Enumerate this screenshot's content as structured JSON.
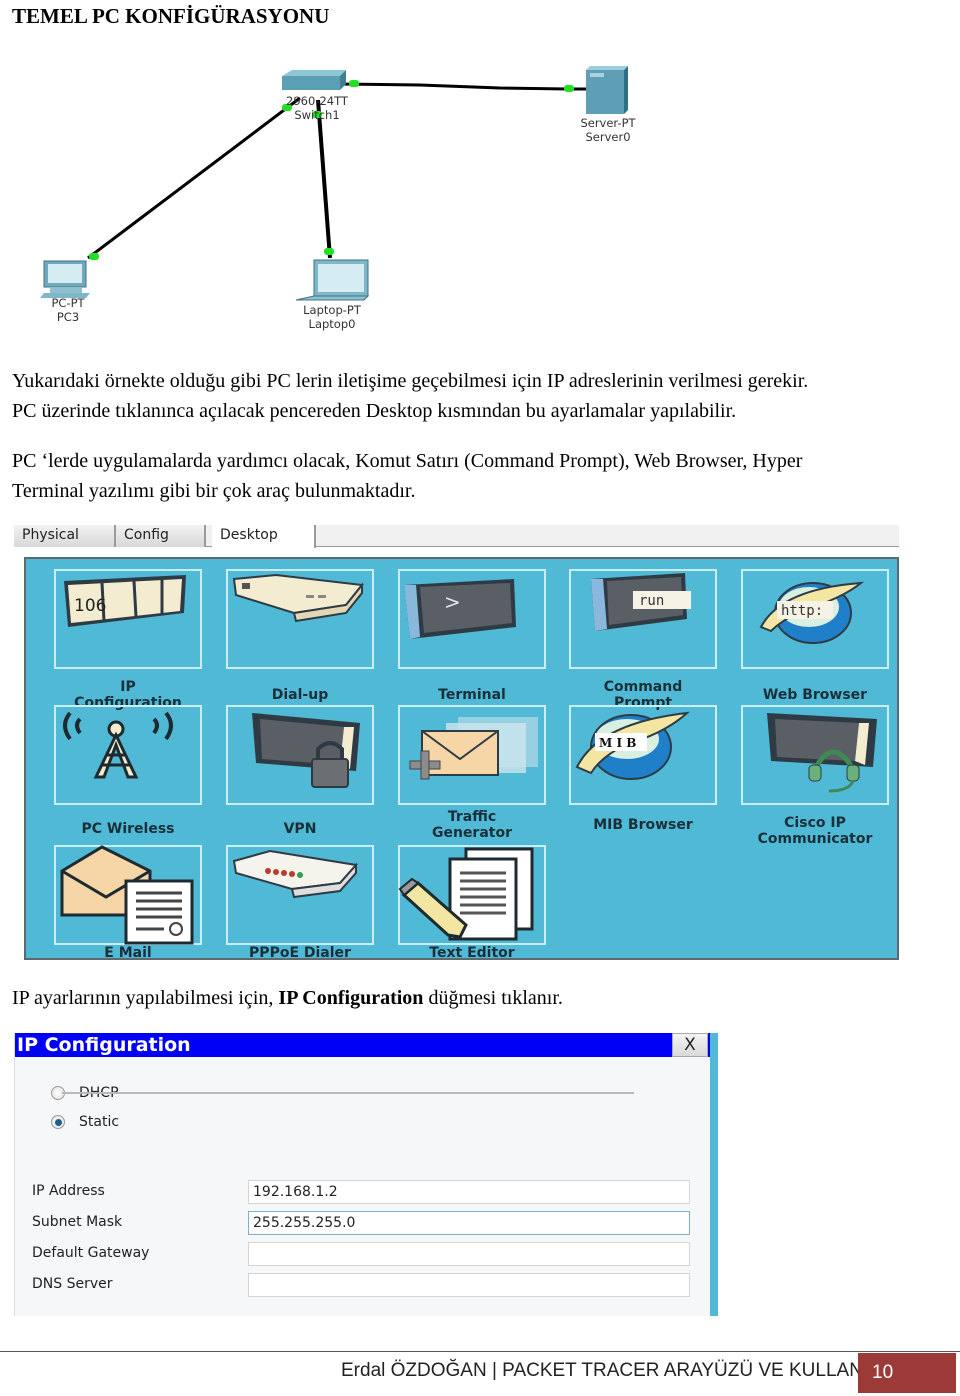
{
  "heading": "TEMEL PC KONFİGÜRASYONU",
  "topology": {
    "devices": [
      {
        "id": "switch",
        "model": "2960-24TT",
        "name": "Switch1",
        "icon": "switch-icon"
      },
      {
        "id": "server",
        "model": "Server-PT",
        "name": "Server0",
        "icon": "server-icon"
      },
      {
        "id": "pc",
        "model": "PC-PT",
        "name": "PC3",
        "icon": "desktop-pc-icon"
      },
      {
        "id": "laptop",
        "model": "Laptop-PT",
        "name": "Laptop0",
        "icon": "laptop-icon"
      }
    ],
    "links": [
      {
        "from": "switch",
        "to": "server",
        "status": "up"
      },
      {
        "from": "switch",
        "to": "pc",
        "status": "up"
      },
      {
        "from": "switch",
        "to": "laptop",
        "status": "up"
      }
    ],
    "link_color": "#000000",
    "link_light_color": "#22e022"
  },
  "paragraphs": {
    "p1_line1": "Yukarıdaki örnekte olduğu gibi PC lerin iletişime geçebilmesi için IP adreslerinin verilmesi gerekir.",
    "p1_line2": "PC üzerinde tıklanınca açılacak pencereden Desktop kısmından bu ayarlamalar yapılabilir.",
    "p2_line1": "PC ‘lerde uygulamalarda yardımcı olacak, Komut Satırı (Command Prompt), Web Browser, Hyper",
    "p2_line2": "Terminal yazılımı gibi bir çok araç bulunmaktadır.",
    "p3_pre": "IP ayarlarının yapılabilmesi için, ",
    "p3_bold": "IP Configuration",
    "p3_post": " düğmesi tıklanır."
  },
  "device_window": {
    "tabs": [
      {
        "label": "Physical",
        "active": false
      },
      {
        "label": "Config",
        "active": false
      },
      {
        "label": "Desktop",
        "active": true
      }
    ],
    "desktop_bg": "#4fb9d6",
    "apps": [
      {
        "label_line1": "IP",
        "label_line2": "Configuration",
        "icon": "ip-configuration-icon",
        "icon_text": "106"
      },
      {
        "label_line1": "Dial-up",
        "label_line2": "",
        "icon": "dial-up-modem-icon"
      },
      {
        "label_line1": "Terminal",
        "label_line2": "",
        "icon": "terminal-icon",
        "icon_text": ">"
      },
      {
        "label_line1": "Command",
        "label_line2": "Prompt",
        "icon": "command-prompt-icon",
        "icon_text": "run"
      },
      {
        "label_line1": "Web Browser",
        "label_line2": "",
        "icon": "web-browser-icon",
        "icon_text": "http:"
      },
      {
        "label_line1": "PC Wireless",
        "label_line2": "",
        "icon": "wireless-tower-icon"
      },
      {
        "label_line1": "VPN",
        "label_line2": "",
        "icon": "vpn-lock-icon"
      },
      {
        "label_line1": "Traffic",
        "label_line2": "Generator",
        "icon": "traffic-generator-icon"
      },
      {
        "label_line1": "MIB Browser",
        "label_line2": "",
        "icon": "mib-browser-icon",
        "icon_text": "M I B"
      },
      {
        "label_line1": "Cisco IP",
        "label_line2": "Communicator",
        "icon": "ip-communicator-headset-icon"
      },
      {
        "label_line1": "E Mail",
        "label_line2": "",
        "icon": "email-icon"
      },
      {
        "label_line1": "PPPoE Dialer",
        "label_line2": "",
        "icon": "pppoe-dialer-icon"
      },
      {
        "label_line1": "Text Editor",
        "label_line2": "",
        "icon": "text-editor-icon"
      }
    ]
  },
  "ip_config": {
    "title": "IP Configuration",
    "close_label": "X",
    "title_bg": "#0000f5",
    "modes": [
      {
        "label": "DHCP",
        "selected": false
      },
      {
        "label": "Static",
        "selected": true
      }
    ],
    "fields": [
      {
        "label": "IP Address",
        "value": "192.168.1.2"
      },
      {
        "label": "Subnet Mask",
        "value": "255.255.255.0"
      },
      {
        "label": "Default Gateway",
        "value": ""
      },
      {
        "label": "DNS Server",
        "value": ""
      }
    ]
  },
  "footer": {
    "text": "Erdal ÖZDOĞAN | PACKET TRACER ARAYÜZÜ VE KULLANIMI",
    "page_number": "10",
    "accent": "#9b3a37"
  }
}
